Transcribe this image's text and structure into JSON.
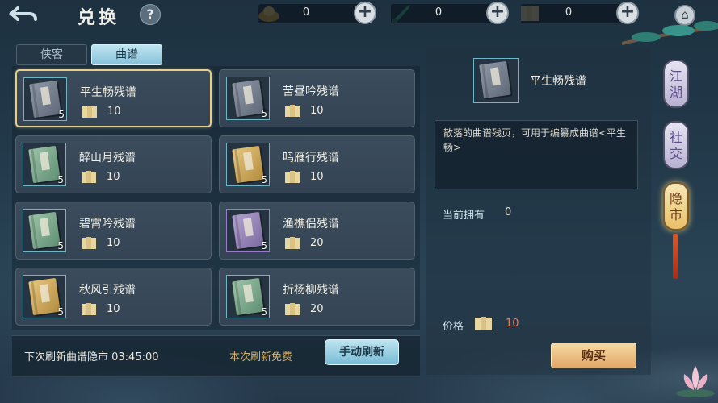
{
  "header": {
    "back_icon": "back-arrow-icon",
    "title": "兑换",
    "help_label": "?",
    "home_icon": "home-icon"
  },
  "resources": [
    {
      "icon": "gold-ingot-icon",
      "value": "0"
    },
    {
      "icon": "jade-knife-icon",
      "value": "0"
    },
    {
      "icon": "scroll-bundle-icon",
      "value": "0"
    }
  ],
  "tabs": [
    {
      "label": "侠客",
      "active": false
    },
    {
      "label": "曲谱",
      "active": true
    }
  ],
  "items": [
    {
      "name": "平生畅残谱",
      "qty": "5",
      "cost": "10",
      "book": "gray",
      "selected": true
    },
    {
      "name": "苦昼吟残谱",
      "qty": "5",
      "cost": "10",
      "book": "gray",
      "selected": false
    },
    {
      "name": "醉山月残谱",
      "qty": "5",
      "cost": "10",
      "book": "green",
      "selected": false
    },
    {
      "name": "鸣雁行残谱",
      "qty": "5",
      "cost": "10",
      "book": "yellow",
      "selected": false
    },
    {
      "name": "碧霄吟残谱",
      "qty": "5",
      "cost": "10",
      "book": "green",
      "selected": false
    },
    {
      "name": "渔樵侣残谱",
      "qty": "5",
      "cost": "20",
      "book": "purple",
      "selected": false
    },
    {
      "name": "秋风引残谱",
      "qty": "5",
      "cost": "10",
      "book": "yellow",
      "selected": false
    },
    {
      "name": "折杨柳残谱",
      "qty": "5",
      "cost": "20",
      "book": "green",
      "selected": false
    }
  ],
  "footer": {
    "refresh_text": "下次刷新曲谱隐市 03:45:00",
    "free_text": "本次刷新免费",
    "refresh_button": "手动刷新"
  },
  "detail": {
    "name": "平生畅残谱",
    "description": "散落的曲谱残页，可用于编纂成曲谱<平生畅>",
    "own_label": "当前拥有",
    "own_value": "0",
    "price_label": "价格",
    "price_value": "10",
    "buy_button": "购买"
  },
  "side_nav": [
    {
      "label": "江湖",
      "active": false
    },
    {
      "label": "社交",
      "active": false
    },
    {
      "label": "隐市",
      "active": true
    }
  ]
}
